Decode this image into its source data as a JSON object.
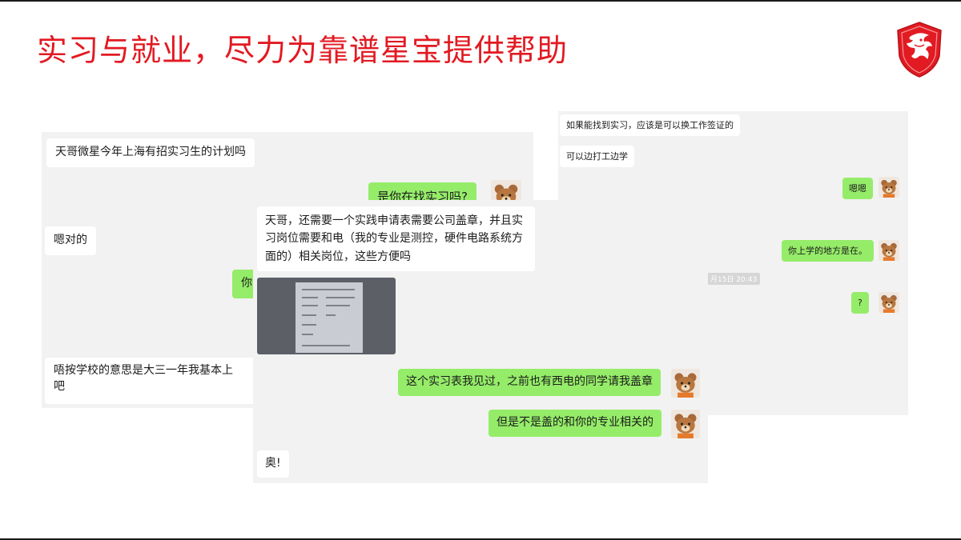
{
  "slide": {
    "title": "实习与就业，尽力为靠谱星宝提供帮助",
    "logo": {
      "icon": "dragon-shield-icon",
      "color": "#e21a22"
    }
  },
  "colors": {
    "title": "#e21a22",
    "panel_bg": "#f2f2f2",
    "incoming_bubble": "#ffffff",
    "outgoing_bubble": "#95ec69"
  },
  "chat_left": {
    "messages": [
      {
        "side": "in",
        "text": "天哥微星今年上海有招实习生的计划吗"
      },
      {
        "side": "out",
        "text": "是你在找实习吗?"
      },
      {
        "side": "in",
        "text": "嗯对的"
      },
      {
        "side": "out",
        "text": "你"
      },
      {
        "side": "in",
        "text": "唔按学校的意思是大三一年我基本上"
      },
      {
        "side": "in",
        "text": "吧"
      }
    ]
  },
  "chat_right": {
    "messages": [
      {
        "side": "in",
        "text": "如果能找到实习，应该是可以换工作签证的"
      },
      {
        "side": "in",
        "text": "可以边打工边学"
      },
      {
        "side": "out",
        "text": "嗯嗯"
      },
      {
        "side": "out",
        "text": "你上学的地方是在。"
      },
      {
        "side": "out",
        "text": "?"
      }
    ],
    "timestamp": "月15日 20:43"
  },
  "chat_front": {
    "messages": [
      {
        "side": "in",
        "text": "天哥，还需要一个实践申请表需要公司盖章，并且实习岗位需要和电（我的专业是测控，硬件电路系统方面的）相关岗位，这些方便吗"
      },
      {
        "side": "in",
        "type": "image",
        "text": ""
      },
      {
        "side": "out",
        "text": "这个实习表我见过，之前也有西电的同学请我盖章"
      },
      {
        "side": "out",
        "text": "但是不是盖的和你的专业相关的"
      },
      {
        "side": "in",
        "text": "奥!"
      }
    ]
  },
  "avatar_icon": "bear-avatar-icon"
}
